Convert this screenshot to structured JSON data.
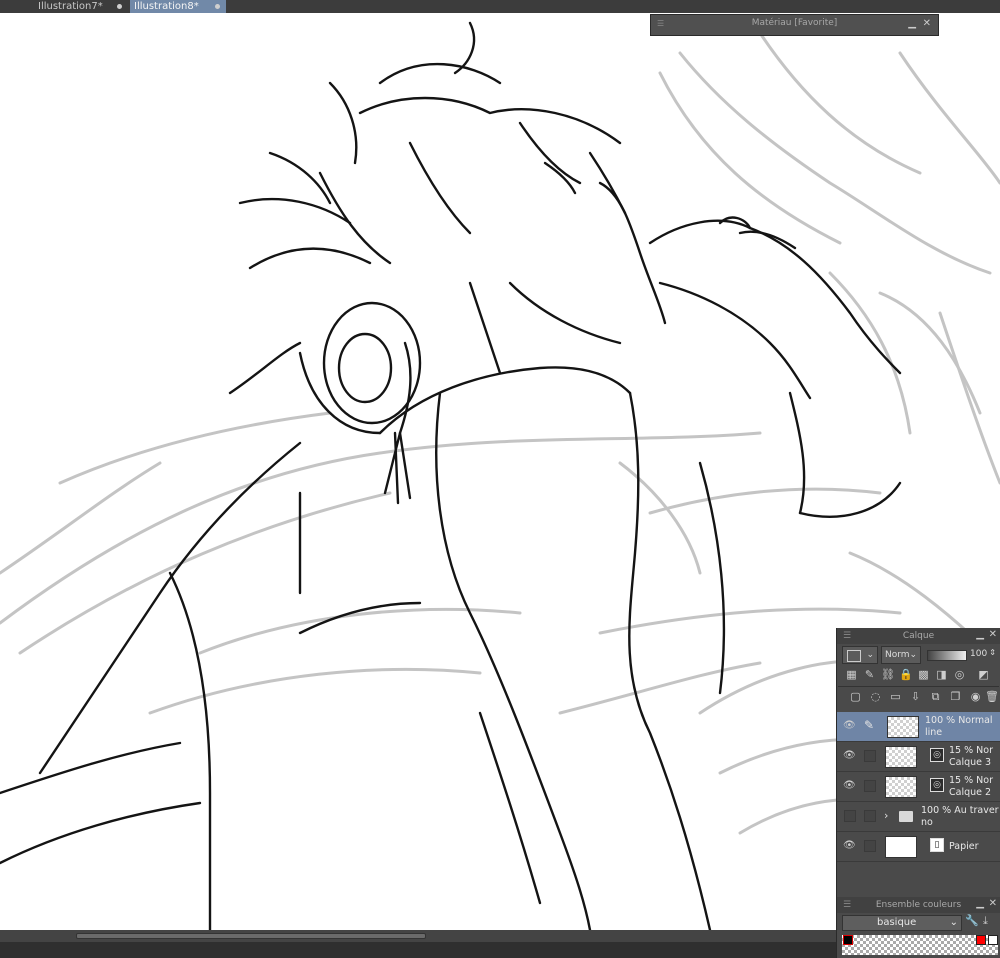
{
  "tabs": [
    {
      "label": "Illustration7*",
      "active": false
    },
    {
      "label": "Illustration8*",
      "active": true
    }
  ],
  "material_panel": {
    "title": "Matériau [Favorite]"
  },
  "layer_panel": {
    "title": "Calque",
    "blend_mode": "Norm",
    "opacity": "100",
    "layers": [
      {
        "line1": "100 % Normal",
        "line2": "line",
        "selected": true,
        "visible": true,
        "kind": "raster"
      },
      {
        "line1": "15 % Nor",
        "line2": "Calque 3",
        "selected": false,
        "visible": true,
        "kind": "raster-mask"
      },
      {
        "line1": "15 % Nor",
        "line2": "Calque 2",
        "selected": false,
        "visible": true,
        "kind": "raster-mask"
      },
      {
        "line1": "100 % Au travers",
        "line2": "no",
        "selected": false,
        "visible": false,
        "kind": "folder"
      },
      {
        "line1": "",
        "line2": "Papier",
        "selected": false,
        "visible": true,
        "kind": "paper"
      }
    ]
  },
  "color_panel": {
    "title": "Ensemble couleurs",
    "set_name": "basique",
    "colors": [
      "#000000",
      "#ff0000",
      "#ffffff"
    ]
  },
  "colors": {
    "active_tab": "#7189a8",
    "selected_layer": "#6f85a6",
    "panel_bg": "#4a4a4a"
  }
}
